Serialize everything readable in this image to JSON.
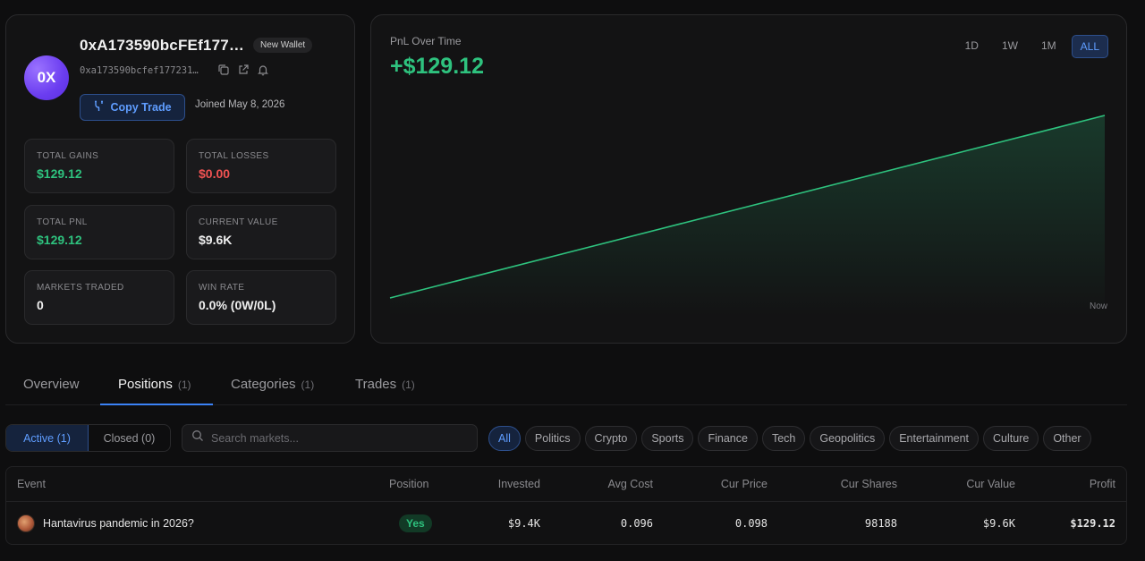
{
  "profile": {
    "avatar_text": "0X",
    "wallet_name": "0xA173590bcFEf177…",
    "badge": "New Wallet",
    "address": "0xa173590bcfef177231…",
    "copy_trade_label": "Copy Trade",
    "joined": "Joined May 8, 2026",
    "stats": [
      {
        "label": "TOTAL GAINS",
        "value": "$129.12",
        "color": "#2ec27e"
      },
      {
        "label": "TOTAL LOSSES",
        "value": "$0.00",
        "color": "#f05252"
      },
      {
        "label": "TOTAL PNL",
        "value": "$129.12",
        "color": "#2ec27e"
      },
      {
        "label": "CURRENT VALUE",
        "value": "$9.6K",
        "color": "#efefef"
      },
      {
        "label": "MARKETS TRADED",
        "value": "0",
        "color": "#efefef"
      },
      {
        "label": "WIN RATE",
        "value": "0.0% (0W/0L)",
        "color": "#efefef"
      }
    ]
  },
  "pnl": {
    "title": "PnL Over Time",
    "value": "+$129.12",
    "ranges": [
      "1D",
      "1W",
      "1M",
      "ALL"
    ],
    "active_range": "ALL",
    "x_end_label": "Now"
  },
  "chart_data": {
    "type": "area",
    "x": [
      "start",
      "Now"
    ],
    "values": [
      0,
      129.12
    ],
    "xlabel": "",
    "ylabel": "",
    "grid": false,
    "color": "#2ec27e"
  },
  "tabs": [
    {
      "label": "Overview",
      "count": ""
    },
    {
      "label": "Positions",
      "count": "(1)"
    },
    {
      "label": "Categories",
      "count": "(1)"
    },
    {
      "label": "Trades",
      "count": "(1)"
    }
  ],
  "filters": {
    "active_label": "Active (1)",
    "closed_label": "Closed (0)",
    "search_placeholder": "Search markets...",
    "categories": [
      "All",
      "Politics",
      "Crypto",
      "Sports",
      "Finance",
      "Tech",
      "Geopolitics",
      "Entertainment",
      "Culture",
      "Other"
    ]
  },
  "table": {
    "columns": [
      "Event",
      "Position",
      "Invested",
      "Avg Cost",
      "Cur Price",
      "Cur Shares",
      "Cur Value",
      "Profit"
    ],
    "rows": [
      {
        "event": "Hantavirus pandemic in 2026?",
        "position": "Yes",
        "invested": "$9.4K",
        "avg_cost": "0.096",
        "cur_price": "0.098",
        "cur_shares": "98188",
        "cur_value": "$9.6K",
        "profit": "$129.12"
      }
    ]
  },
  "colors": {
    "accent": "#3b82f6",
    "positive": "#2ec27e",
    "negative": "#f05252",
    "background": "#0e0e0f"
  }
}
